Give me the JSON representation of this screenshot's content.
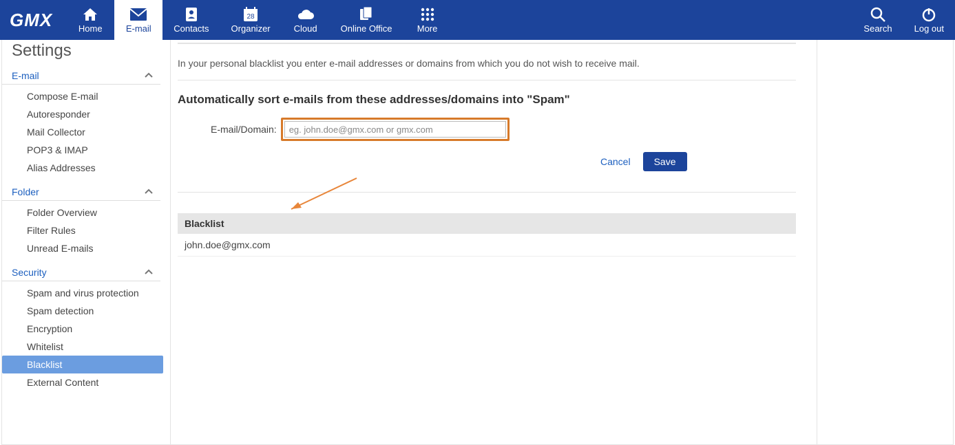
{
  "brand": "GMX",
  "nav": {
    "items": [
      {
        "label": "Home"
      },
      {
        "label": "E-mail"
      },
      {
        "label": "Contacts"
      },
      {
        "label": "Organizer",
        "badge": "28"
      },
      {
        "label": "Cloud"
      },
      {
        "label": "Online Office"
      },
      {
        "label": "More"
      }
    ],
    "right": [
      {
        "label": "Search"
      },
      {
        "label": "Log out"
      }
    ]
  },
  "sidebar": {
    "title": "Settings",
    "sections": [
      {
        "label": "E-mail",
        "items": [
          {
            "label": "Compose E-mail"
          },
          {
            "label": "Autoresponder"
          },
          {
            "label": "Mail Collector"
          },
          {
            "label": "POP3 & IMAP"
          },
          {
            "label": "Alias Addresses"
          }
        ]
      },
      {
        "label": "Folder",
        "items": [
          {
            "label": "Folder Overview"
          },
          {
            "label": "Filter Rules"
          },
          {
            "label": "Unread E-mails"
          }
        ]
      },
      {
        "label": "Security",
        "items": [
          {
            "label": "Spam and virus protection"
          },
          {
            "label": "Spam detection"
          },
          {
            "label": "Encryption"
          },
          {
            "label": "Whitelist"
          },
          {
            "label": "Blacklist",
            "selected": true
          },
          {
            "label": "External Content"
          }
        ]
      }
    ]
  },
  "main": {
    "description": "In your personal blacklist you enter e-mail addresses or domains from which you do not wish to receive mail.",
    "section_title": "Automatically sort e-mails from these addresses/domains into \"Spam\"",
    "form": {
      "label": "E-mail/Domain:",
      "placeholder": "eg. john.doe@gmx.com or gmx.com",
      "value": ""
    },
    "buttons": {
      "cancel": "Cancel",
      "save": "Save"
    },
    "list": {
      "header": "Blacklist",
      "rows": [
        "john.doe@gmx.com"
      ]
    }
  }
}
